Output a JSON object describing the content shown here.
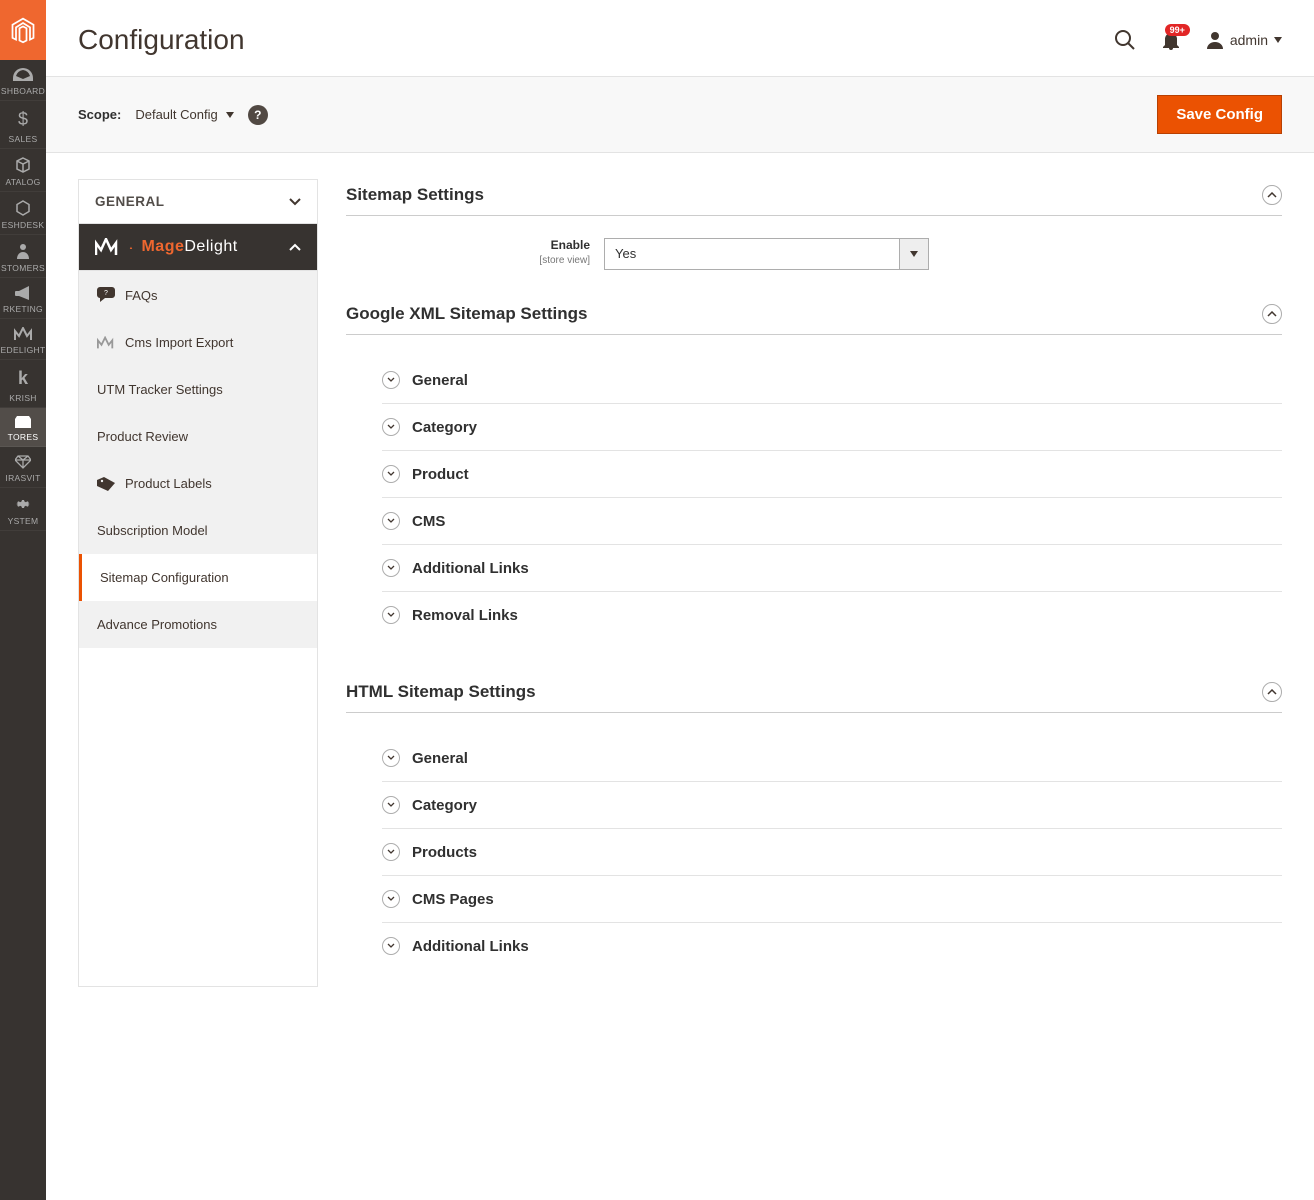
{
  "sidebar": {
    "items": [
      {
        "label": "SHBOARD"
      },
      {
        "label": "SALES"
      },
      {
        "label": "ATALOG"
      },
      {
        "label": "ESHDESK"
      },
      {
        "label": "STOMERS"
      },
      {
        "label": "RKETING"
      },
      {
        "label": "EDELIGHT"
      },
      {
        "label": "KRISH"
      },
      {
        "label": "TORES"
      },
      {
        "label": "IRASVIT"
      },
      {
        "label": "YSTEM"
      }
    ]
  },
  "header": {
    "title": "Configuration",
    "notifications_badge": "99+",
    "user_name": "admin"
  },
  "scope": {
    "label": "Scope:",
    "selected": "Default Config",
    "save_button": "Save Config"
  },
  "config_tabs": {
    "general": "GENERAL",
    "vendor_brand1": "Mage",
    "vendor_brand2": "Delight",
    "items": [
      {
        "label": "FAQs"
      },
      {
        "label": "Cms Import Export"
      },
      {
        "label": "UTM Tracker Settings"
      },
      {
        "label": "Product Review"
      },
      {
        "label": "Product Labels"
      },
      {
        "label": "Subscription Model"
      },
      {
        "label": "Sitemap Configuration"
      },
      {
        "label": "Advance Promotions"
      }
    ]
  },
  "sections": {
    "sitemap": {
      "title": "Sitemap Settings",
      "enable_label": "Enable",
      "enable_scope": "[store view]",
      "enable_value": "Yes"
    },
    "google_xml": {
      "title": "Google XML Sitemap Settings",
      "subs": [
        {
          "label": "General"
        },
        {
          "label": "Category"
        },
        {
          "label": "Product"
        },
        {
          "label": "CMS"
        },
        {
          "label": "Additional Links"
        },
        {
          "label": "Removal Links"
        }
      ]
    },
    "html_sitemap": {
      "title": "HTML Sitemap Settings",
      "subs": [
        {
          "label": "General"
        },
        {
          "label": "Category"
        },
        {
          "label": "Products"
        },
        {
          "label": "CMS Pages"
        },
        {
          "label": "Additional Links"
        }
      ]
    }
  }
}
